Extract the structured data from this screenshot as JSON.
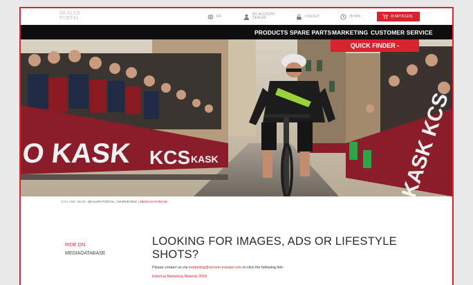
{
  "logo": {
    "line1": "DEALER",
    "line2": "PORTAL"
  },
  "topbar": {
    "language_label": "EN",
    "account_label": "MY ACCOUNT",
    "account_sub": "DEALER",
    "logout_label": "LOGOUT",
    "timer_label": "38 MIN",
    "cart_label": "(0 ARTICLES)"
  },
  "nav": {
    "products": "PRODUCTS",
    "spare_parts": "SPARE PARTS",
    "marketing": "MARKETING",
    "customer_service": "CUSTOMER SERVICE"
  },
  "quick_finder": {
    "label": "QUICK FINDER -"
  },
  "hero": {
    "banner_text_left": "O KASK",
    "banner_text_mid1": "KCS",
    "banner_text_mid2": "KASK",
    "banner_text_right": "KASK KCS"
  },
  "breadcrumb": {
    "prefix": "YOU ARE HERE:",
    "item1": "DEALER PORTAL",
    "sep": "|",
    "item2": "MARKETING",
    "item3": "MEDIADATABASE"
  },
  "sidebar": {
    "ride_on": "RIDE ON",
    "mediadatabase": "MEDIADATABASE"
  },
  "content": {
    "title": "LOOKING FOR IMAGES, ADS OR LIFESTYLE SHOTS?",
    "contact_prefix": "Please contact us via",
    "email": "marketing@cervelo-europe.com",
    "contact_suffix": "or click the following link:",
    "external_link": "External Marketing Material 2018"
  },
  "colors": {
    "accent": "#d9232e",
    "nav_bg": "#0e0e0e"
  }
}
